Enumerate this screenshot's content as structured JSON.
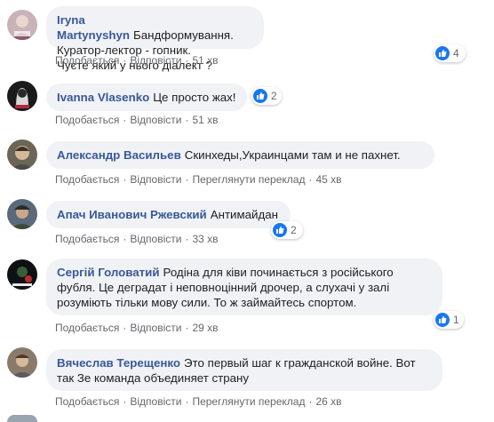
{
  "theme": {
    "link": "#385898",
    "bubble": "#f0f2f5",
    "muted": "#65676b",
    "like": "#1877f2"
  },
  "comments": [
    {
      "author": "Iryna Martynyshyn",
      "text_lines": [
        "Бандформування. Куратор-лектор - гопник.",
        "Чуєте який у нього діалект ?"
      ],
      "actions": [
        "Подобається",
        "Відповісти",
        "51 хв"
      ],
      "reactions": "4"
    },
    {
      "author": "Ivanna Vlasenko",
      "text_lines": [
        "Це просто жах!"
      ],
      "actions": [
        "Подобається",
        "Відповісти",
        "51 хв"
      ],
      "reactions": "2"
    },
    {
      "author": "Александр Васильев",
      "text_lines": [
        "Скинхеды,Украинцами там и не пахнет."
      ],
      "actions": [
        "Подобається",
        "Відповісти",
        "Переглянути переклад",
        "45 хв"
      ],
      "reactions": ""
    },
    {
      "author": "Апач Иванович Ржевский",
      "text_lines": [
        "Антимайдан"
      ],
      "actions": [
        "Подобається",
        "Відповісти",
        "33 хв"
      ],
      "reactions": "2"
    },
    {
      "author": "Сергій Головатий",
      "text_lines": [
        "Родіна для ківи починається з російського",
        "фубля. Це деградат і неповноцінний дрочер, а слухачі у залі",
        "розуміють тільки мову сили. То ж займайтесь спортом."
      ],
      "actions": [
        "Подобається",
        "Відповісти",
        "29 хв"
      ],
      "reactions": "1"
    },
    {
      "author": "Вячеслав Терещенко",
      "text_lines": [
        "Это первый шаг к гражданской войне. Вот",
        "так Зе команда объединяет страну"
      ],
      "actions": [
        "Подобається",
        "Відповісти",
        "Переглянути переклад",
        "26 хв"
      ],
      "reactions": ""
    }
  ]
}
